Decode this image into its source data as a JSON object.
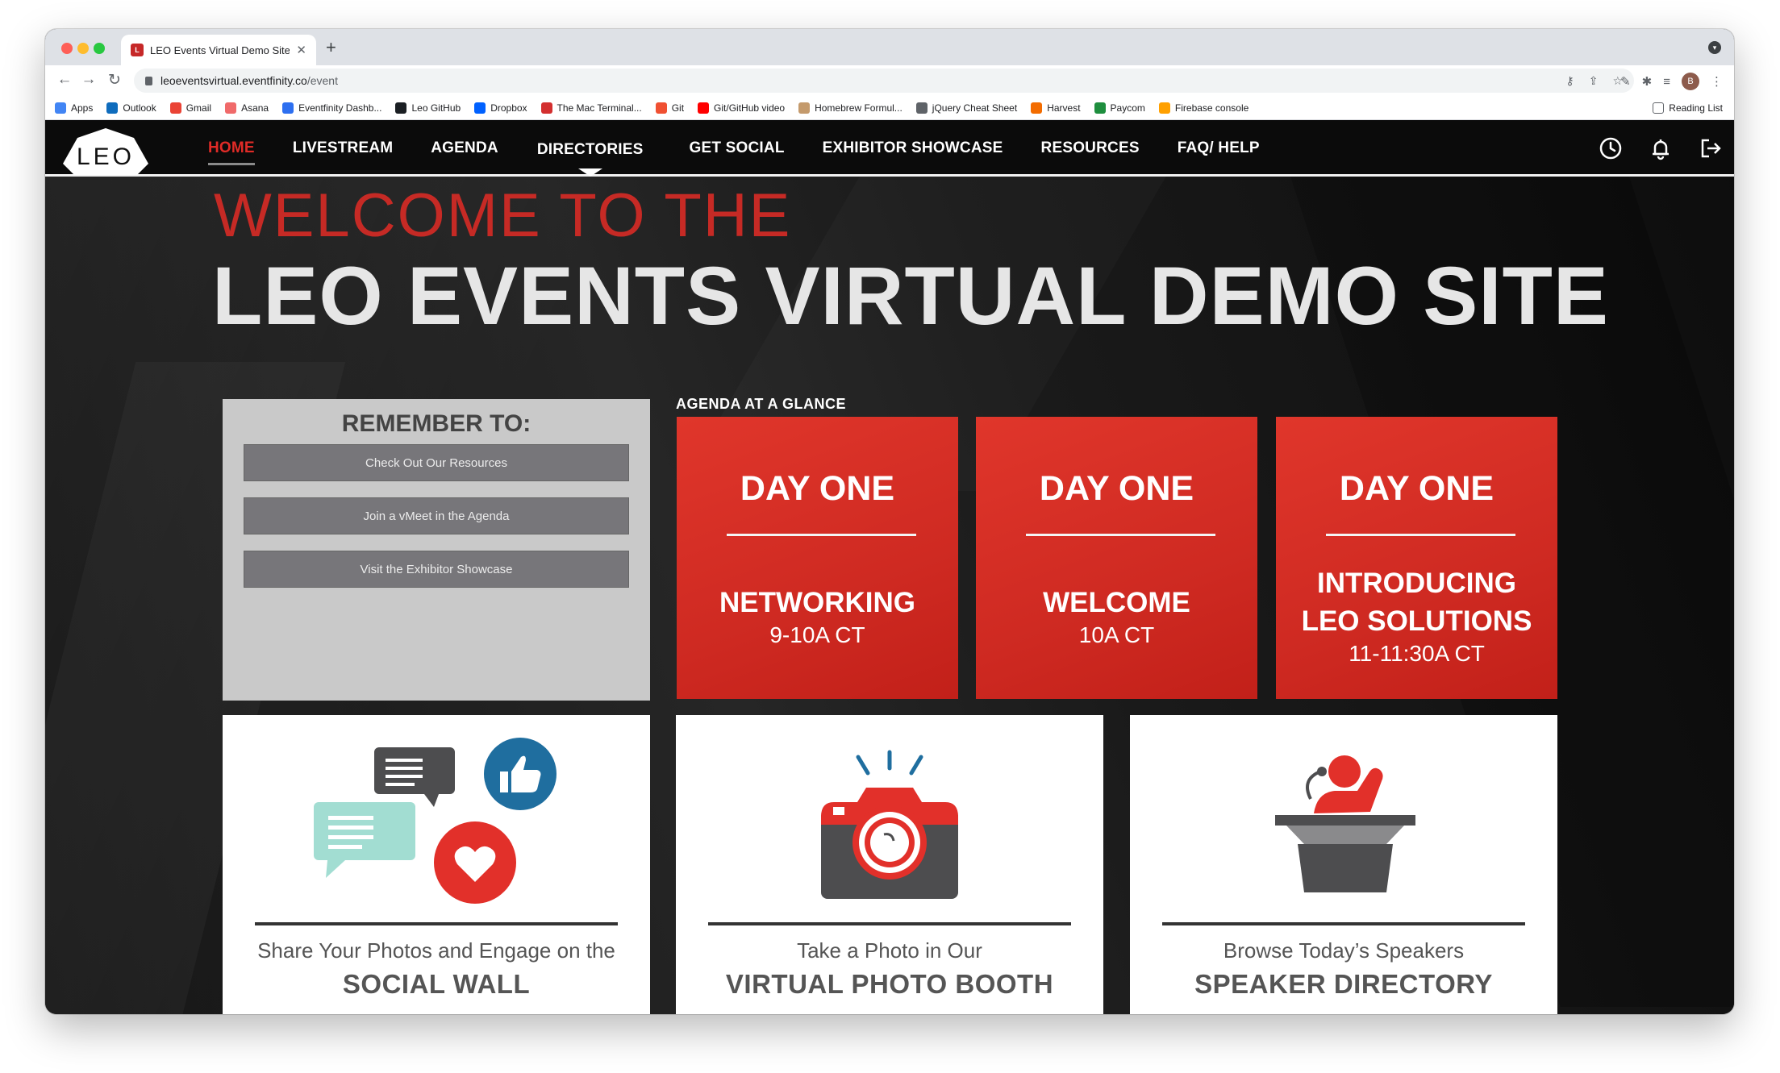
{
  "browser": {
    "tab_title": "LEO Events Virtual Demo Site",
    "url_host": "leoeventsvirtual.eventfinity.co",
    "url_path": "/event",
    "bookmarks": [
      {
        "label": "Apps",
        "icon": "apps-grid-icon",
        "color": "#4285f4"
      },
      {
        "label": "Outlook",
        "icon": "outlook-icon",
        "color": "#0f6cbd"
      },
      {
        "label": "Gmail",
        "icon": "gmail-icon",
        "color": "#ea4335"
      },
      {
        "label": "Asana",
        "icon": "asana-icon",
        "color": "#f06a6a"
      },
      {
        "label": "Eventfinity Dashb...",
        "icon": "eventfinity-icon",
        "color": "#2d6ff0"
      },
      {
        "label": "Leo GitHub",
        "icon": "github-icon",
        "color": "#1b1f23"
      },
      {
        "label": "Dropbox",
        "icon": "dropbox-icon",
        "color": "#0061ff"
      },
      {
        "label": "The Mac Terminal...",
        "icon": "terminal-icon",
        "color": "#d32f2f"
      },
      {
        "label": "Git",
        "icon": "git-icon",
        "color": "#f05032"
      },
      {
        "label": "Git/GitHub video",
        "icon": "youtube-icon",
        "color": "#ff0000"
      },
      {
        "label": "Homebrew Formul...",
        "icon": "homebrew-icon",
        "color": "#c49a6c"
      },
      {
        "label": "jQuery Cheat Sheet",
        "icon": "globe-icon",
        "color": "#5f6368"
      },
      {
        "label": "Harvest",
        "icon": "harvest-icon",
        "color": "#f36c00"
      },
      {
        "label": "Paycom",
        "icon": "paycom-icon",
        "color": "#1e8e3e"
      },
      {
        "label": "Firebase console",
        "icon": "firebase-icon",
        "color": "#ffa000"
      }
    ],
    "reading_list": "Reading List",
    "profile_initial": "B"
  },
  "site": {
    "logo": "LEO",
    "nav": [
      {
        "label": "HOME",
        "active": true
      },
      {
        "label": "LIVESTREAM"
      },
      {
        "label": "AGENDA"
      },
      {
        "label": "DIRECTORIES"
      },
      {
        "label": "GET SOCIAL"
      },
      {
        "label": "EXHIBITOR SHOWCASE"
      },
      {
        "label": "RESOURCES"
      },
      {
        "label": "FAQ/ HELP"
      }
    ],
    "welcome_line1": "WELCOME TO THE",
    "welcome_line2": "LEO EVENTS VIRTUAL DEMO SITE",
    "remember": {
      "title": "REMEMBER TO:",
      "buttons": [
        "Check Out Our Resources",
        "Join a vMeet in the Agenda",
        "Visit the Exhibitor Showcase"
      ]
    },
    "agenda_label": "AGENDA AT A GLANCE",
    "agenda": [
      {
        "day": "DAY ONE",
        "name": "NETWORKING",
        "time": "9-10A CT"
      },
      {
        "day": "DAY ONE",
        "name": "WELCOME",
        "time": "10A CT"
      },
      {
        "day": "DAY ONE",
        "name": "INTRODUCING\nLEO SOLUTIONS",
        "time": "11-11:30A CT"
      }
    ],
    "features": [
      {
        "subtitle": "Share Your Photos and Engage on the",
        "title": "SOCIAL WALL"
      },
      {
        "subtitle": "Take a Photo in Our",
        "title": "VIRTUAL PHOTO BOOTH"
      },
      {
        "subtitle": "Browse Today’s Speakers",
        "title": "SPEAKER DIRECTORY"
      }
    ],
    "colors": {
      "brand_red": "#e02b27",
      "card_red": "#d3302a",
      "nav_bg": "#0b0b0b"
    }
  }
}
